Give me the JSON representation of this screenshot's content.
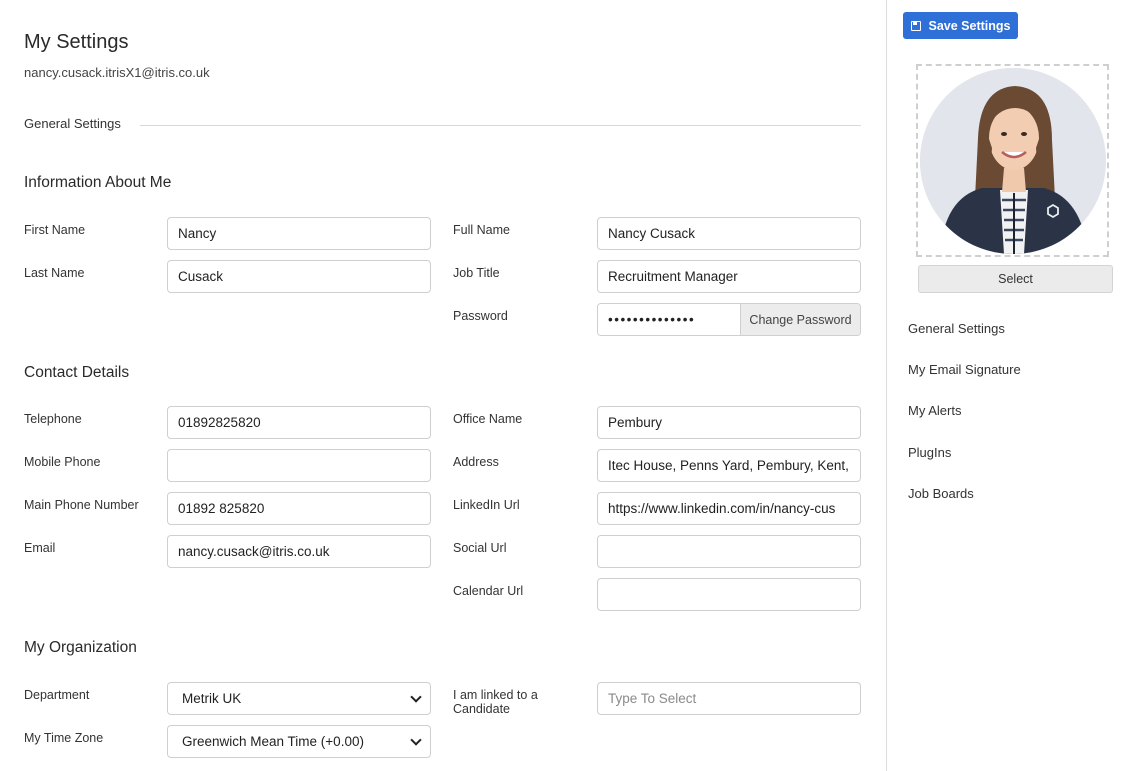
{
  "page": {
    "title": "My Settings",
    "email": "nancy.cusack.itrisX1@itris.co.uk",
    "section_tab": "General Settings"
  },
  "info": {
    "title": "Information About Me",
    "first_name_label": "First Name",
    "first_name": "Nancy",
    "last_name_label": "Last Name",
    "last_name": "Cusack",
    "full_name_label": "Full Name",
    "full_name": "Nancy Cusack",
    "job_title_label": "Job Title",
    "job_title": "Recruitment Manager",
    "password_label": "Password",
    "password": "••••••••••••••",
    "change_password": "Change Password"
  },
  "contact": {
    "title": "Contact Details",
    "telephone_label": "Telephone",
    "telephone": "01892825820",
    "mobile_label": "Mobile Phone",
    "mobile": "",
    "main_phone_label": "Main Phone Number",
    "main_phone": "01892 825820",
    "email_label": "Email",
    "email": "nancy.cusack@itris.co.uk",
    "office_label": "Office Name",
    "office": "Pembury",
    "address_label": "Address",
    "address": "Itec House, Penns Yard, Pembury, Kent,",
    "linkedin_label": "LinkedIn Url",
    "linkedin": "https://www.linkedin.com/in/nancy-cus",
    "social_label": "Social Url",
    "social": "",
    "calendar_label": "Calendar Url",
    "calendar": ""
  },
  "org": {
    "title": "My Organization",
    "department_label": "Department",
    "department": "Metrik UK",
    "timezone_label": "My Time Zone",
    "timezone": "Greenwich Mean Time (+0.00)",
    "linked_label": "I am linked to a Candidate",
    "linked_placeholder": "Type To Select"
  },
  "sidebar": {
    "save_label": "Save Settings",
    "select_label": "Select",
    "nav": [
      "General Settings",
      "My Email Signature",
      "My Alerts",
      "PlugIns",
      "Job Boards"
    ]
  },
  "colors": {
    "accent": "#2f6fd8"
  }
}
